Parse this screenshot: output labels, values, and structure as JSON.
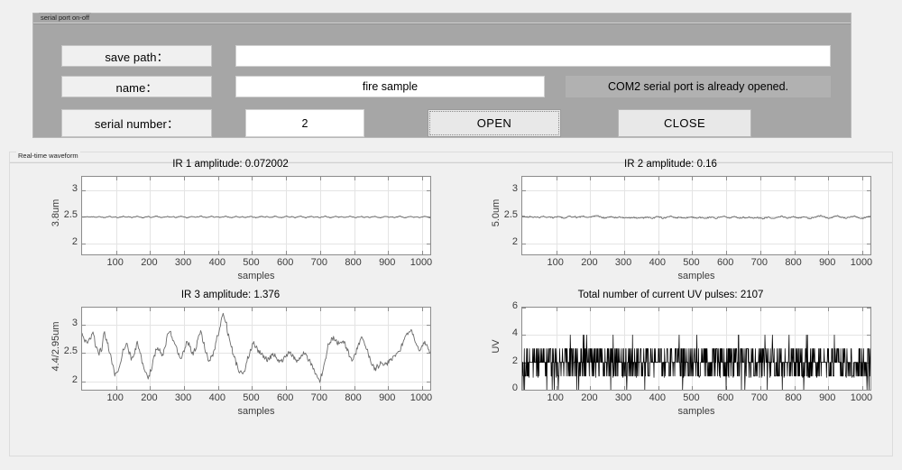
{
  "serial_panel": {
    "title": "serial port on-off",
    "save_path_label": "save path：",
    "save_path_value": "",
    "save_path_placeholder": "",
    "name_label": "name：",
    "name_value": "fire sample",
    "serial_number_label": "serial number：",
    "serial_number_value": "2",
    "status_message": "COM2 serial port is already opened.",
    "open_button": "OPEN",
    "close_button": "CLOSE"
  },
  "waveform_panel": {
    "title": "Real-time waveform"
  },
  "chart_data": [
    {
      "id": "ir1",
      "type": "line",
      "title": "IR 1 amplitude: 0.072002",
      "xlabel": "samples",
      "ylabel": "3.8um",
      "xlim": [
        0,
        1024
      ],
      "ylim": [
        1.8,
        3.25
      ],
      "yticks": [
        2,
        2.5,
        3
      ],
      "xticks": [
        100,
        200,
        300,
        400,
        500,
        600,
        700,
        800,
        900,
        1000
      ],
      "grid": true,
      "line_color": "#6b6b6b",
      "baseline": 2.5,
      "amplitude": 0.072002,
      "values": [
        2.5,
        2.498,
        2.503,
        2.496,
        2.505,
        2.492,
        2.508,
        2.497,
        2.486,
        2.502,
        2.512,
        2.494,
        2.503,
        2.487,
        2.499,
        2.51,
        2.493,
        2.505,
        2.488,
        2.501,
        2.513,
        2.495,
        2.484,
        2.5,
        2.509,
        2.492,
        2.503,
        2.516,
        2.497,
        2.486,
        2.5,
        2.511,
        2.494,
        2.505,
        2.49,
        2.502,
        2.514,
        2.496,
        2.485,
        2.5,
        2.508,
        2.493,
        2.504,
        2.518,
        2.499,
        2.487,
        2.5,
        2.512,
        2.495,
        2.503,
        2.489,
        2.501,
        2.515,
        2.497,
        2.486,
        2.5,
        2.51,
        2.492,
        2.504,
        2.488,
        2.5,
        2.513,
        2.496,
        2.485,
        2.5,
        2.511,
        2.493,
        2.506,
        2.49,
        2.5,
        2.52,
        2.498,
        2.484,
        2.499,
        2.512,
        2.494,
        2.505,
        2.487,
        2.5,
        2.516,
        2.497,
        2.486,
        2.5,
        2.509,
        2.492,
        2.503,
        2.489,
        2.5,
        2.514,
        2.496,
        2.485,
        2.5,
        2.51,
        2.493,
        2.504,
        2.488,
        2.5,
        2.512,
        2.497,
        2.486,
        2.5,
        2.508,
        2.491,
        2.502,
        2.49,
        2.5,
        2.513,
        2.495,
        2.484,
        2.499,
        2.511,
        2.494,
        2.504,
        2.487,
        2.5,
        2.515,
        2.497,
        2.486,
        2.5,
        2.509,
        2.492,
        2.503,
        2.489,
        2.501,
        2.514,
        2.496,
        2.485
      ]
    },
    {
      "id": "ir2",
      "type": "line",
      "title": "IR 2 amplitude: 0.16",
      "xlabel": "samples",
      "ylabel": "5.0um",
      "xlim": [
        0,
        1024
      ],
      "ylim": [
        1.8,
        3.25
      ],
      "yticks": [
        2,
        2.5,
        3
      ],
      "xticks": [
        100,
        200,
        300,
        400,
        500,
        600,
        700,
        800,
        900,
        1000
      ],
      "grid": true,
      "line_color": "#6b6b6b",
      "baseline": 2.5,
      "amplitude": 0.16,
      "values": [
        2.52,
        2.507,
        2.497,
        2.51,
        2.492,
        2.503,
        2.487,
        2.498,
        2.512,
        2.49,
        2.502,
        2.484,
        2.496,
        2.508,
        2.493,
        2.481,
        2.497,
        2.51,
        2.495,
        2.506,
        2.488,
        2.5,
        2.515,
        2.497,
        2.485,
        2.5,
        2.512,
        2.528,
        2.505,
        2.49,
        2.476,
        2.492,
        2.505,
        2.495,
        2.485,
        2.498,
        2.488,
        2.48,
        2.492,
        2.484,
        2.494,
        2.483,
        2.477,
        2.49,
        2.481,
        2.493,
        2.484,
        2.476,
        2.488,
        2.51,
        2.492,
        2.475,
        2.487,
        2.5,
        2.515,
        2.495,
        2.483,
        2.498,
        2.487,
        2.476,
        2.49,
        2.505,
        2.488,
        2.478,
        2.492,
        2.482,
        2.47,
        2.484,
        2.497,
        2.486,
        2.476,
        2.49,
        2.504,
        2.512,
        2.496,
        2.484,
        2.497,
        2.508,
        2.49,
        2.478,
        2.492,
        2.483,
        2.496,
        2.486,
        2.476,
        2.489,
        2.479,
        2.468,
        2.482,
        2.495,
        2.484,
        2.472,
        2.486,
        2.5,
        2.513,
        2.494,
        2.48,
        2.495,
        2.508,
        2.49,
        2.476,
        2.489,
        2.502,
        2.486,
        2.472,
        2.485,
        2.498,
        2.512,
        2.522,
        2.505,
        2.49,
        2.478,
        2.492,
        2.506,
        2.52,
        2.503,
        2.488,
        2.476,
        2.49,
        2.505,
        2.518,
        2.5,
        2.486,
        2.473,
        2.488,
        2.502,
        2.517
      ]
    },
    {
      "id": "ir3",
      "type": "line",
      "title": "IR 3 amplitude: 1.376",
      "xlabel": "samples",
      "ylabel": "4.4/2.95um",
      "xlim": [
        0,
        1024
      ],
      "ylim": [
        1.85,
        3.3
      ],
      "yticks": [
        2,
        2.5,
        3
      ],
      "xticks": [
        100,
        200,
        300,
        400,
        500,
        600,
        700,
        800,
        900,
        1000
      ],
      "grid": true,
      "line_color": "#6b6b6b",
      "baseline": 2.5,
      "amplitude": 1.376,
      "values": [
        2.82,
        2.72,
        2.66,
        2.78,
        2.86,
        2.62,
        2.5,
        2.56,
        2.88,
        2.7,
        2.5,
        2.3,
        2.12,
        2.2,
        2.35,
        2.58,
        2.66,
        2.5,
        2.4,
        2.52,
        2.68,
        2.5,
        2.32,
        2.15,
        2.08,
        2.2,
        2.42,
        2.6,
        2.55,
        2.45,
        2.62,
        2.8,
        2.86,
        2.72,
        2.6,
        2.48,
        2.42,
        2.56,
        2.72,
        2.62,
        2.48,
        2.56,
        2.78,
        2.88,
        2.66,
        2.48,
        2.36,
        2.44,
        2.6,
        2.78,
        3.0,
        3.2,
        3.05,
        2.8,
        2.6,
        2.42,
        2.3,
        2.18,
        2.1,
        2.22,
        2.4,
        2.55,
        2.66,
        2.6,
        2.52,
        2.48,
        2.42,
        2.38,
        2.42,
        2.48,
        2.44,
        2.38,
        2.35,
        2.4,
        2.46,
        2.5,
        2.46,
        2.4,
        2.36,
        2.42,
        2.5,
        2.46,
        2.38,
        2.3,
        2.2,
        2.08,
        2.02,
        2.15,
        2.4,
        2.62,
        2.72,
        2.76,
        2.7,
        2.66,
        2.7,
        2.66,
        2.56,
        2.44,
        2.38,
        2.5,
        2.66,
        2.76,
        2.7,
        2.58,
        2.44,
        2.3,
        2.22,
        2.26,
        2.34,
        2.32,
        2.3,
        2.34,
        2.4,
        2.44,
        2.5,
        2.56,
        2.66,
        2.76,
        2.86,
        2.9,
        2.8,
        2.66,
        2.56,
        2.62,
        2.7,
        2.6,
        2.52
      ]
    },
    {
      "id": "uv",
      "type": "line",
      "title": "Total number of current UV pulses: 2107",
      "xlabel": "samples",
      "ylabel": "UV",
      "xlim": [
        0,
        1024
      ],
      "ylim": [
        0,
        6
      ],
      "yticks": [
        0,
        2,
        4,
        6
      ],
      "xticks": [
        100,
        200,
        300,
        400,
        500,
        600,
        700,
        800,
        900,
        1000
      ],
      "grid": true,
      "line_color": "#000000",
      "pulse_total": 2107,
      "baseline": 2,
      "description": "dense vertical UV pulse spikes between 0 and 4, mostly oscillating between 1 and 3"
    }
  ]
}
